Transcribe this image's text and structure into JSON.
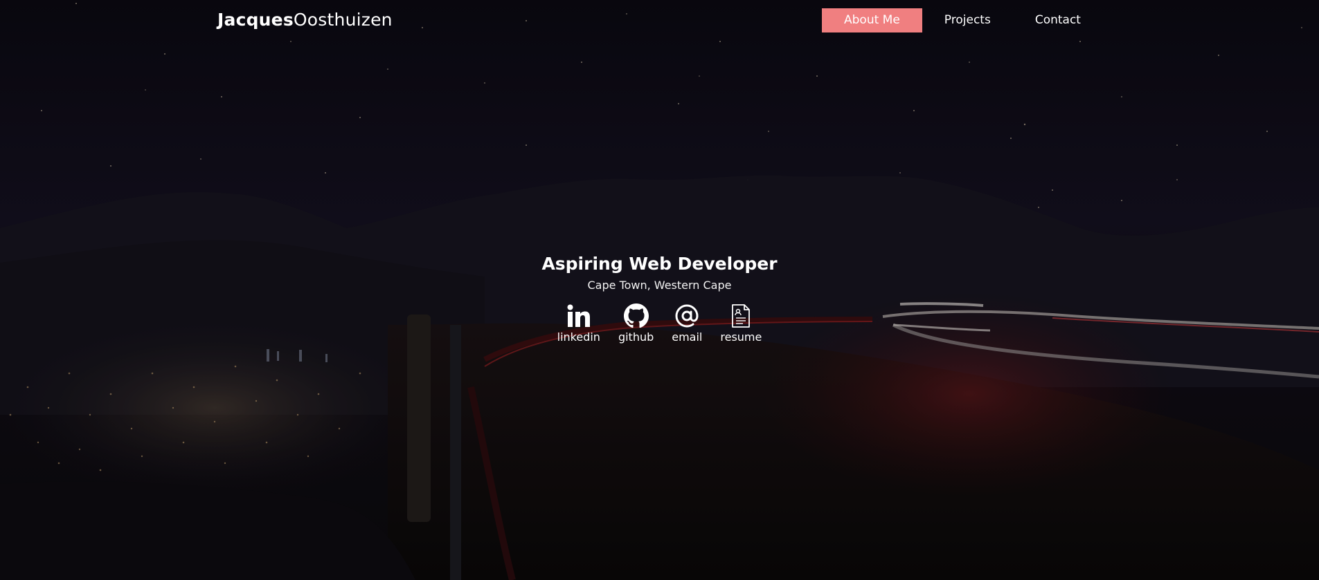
{
  "header": {
    "logo_first": "Jacques",
    "logo_last": "Oosthuizen",
    "nav": [
      {
        "label": "About Me",
        "active": true
      },
      {
        "label": "Projects",
        "active": false
      },
      {
        "label": "Contact",
        "active": false
      }
    ]
  },
  "hero": {
    "title": "Aspiring Web Developer",
    "location": "Cape Town, Western Cape",
    "links": [
      {
        "label": "linkedin",
        "icon": "linkedin-icon"
      },
      {
        "label": "github",
        "icon": "github-icon"
      },
      {
        "label": "email",
        "icon": "at-sign-icon"
      },
      {
        "label": "resume",
        "icon": "resume-document-icon"
      }
    ]
  },
  "colors": {
    "accent": "#f07f80",
    "text": "#ffffff",
    "background": "#0b0912"
  }
}
